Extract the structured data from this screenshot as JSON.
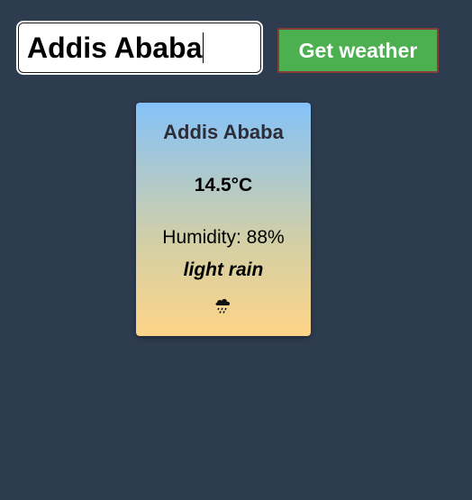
{
  "search": {
    "value": "Addis Ababa",
    "button_label": "Get weather"
  },
  "card": {
    "city": "Addis Ababa",
    "temperature": "14.5°C",
    "humidity_label": "Humidity:",
    "humidity_value": "88%",
    "description": "light rain",
    "icon": "rain-cloud-icon"
  },
  "colors": {
    "background": "#2d3c4f",
    "button": "#4caf50",
    "card_top": "#84c2f9",
    "card_bottom": "#fed488"
  }
}
